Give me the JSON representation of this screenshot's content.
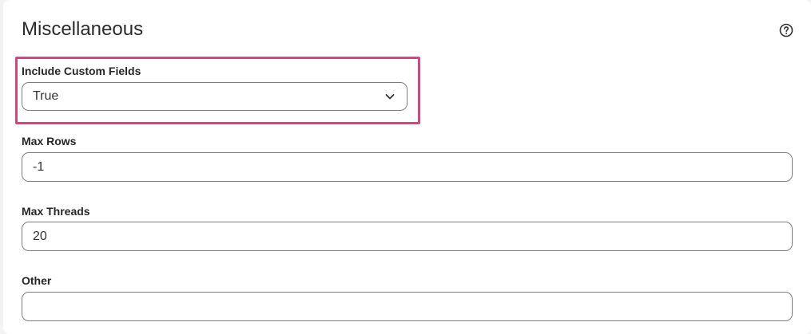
{
  "section": {
    "title": "Miscellaneous",
    "help_icon": "question-circle-icon"
  },
  "fields": {
    "include_custom_fields": {
      "label": "Include Custom Fields",
      "value": "True",
      "icon": "chevron-down-icon"
    },
    "max_rows": {
      "label": "Max Rows",
      "value": "-1"
    },
    "max_threads": {
      "label": "Max Threads",
      "value": "20"
    },
    "other": {
      "label": "Other",
      "value": ""
    }
  },
  "colors": {
    "highlight": "#e13f7d",
    "border": "#7e7e7e"
  }
}
